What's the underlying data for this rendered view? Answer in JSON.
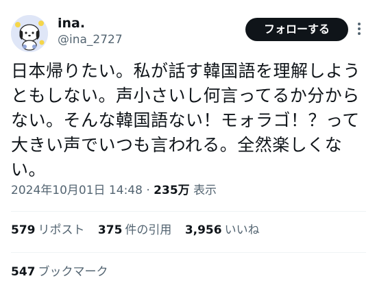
{
  "user": {
    "display_name": "ina.",
    "handle": "@ina_2727",
    "avatar_icon": "pochacco-avatar-icon"
  },
  "follow_button": {
    "label": "フォローする"
  },
  "more_icon": "more-vertical-icon",
  "post": {
    "text": "日本帰りたい。私が話す韓国語を理解しようともしない。声小さいし何言ってるか分からない。そんな韓国語ない！モォラゴ！？って大きい声でいつも言われる。全然楽しくない。"
  },
  "meta": {
    "timestamp": "2024年10月01日 14:48",
    "separator": "·",
    "views_count": "235万",
    "views_label": "表示"
  },
  "stats": {
    "reposts": {
      "count": "579",
      "label": "リポスト"
    },
    "quotes": {
      "count": "375",
      "label": "件の引用"
    },
    "likes": {
      "count": "3,956",
      "label": "いいね"
    }
  },
  "bookmarks": {
    "count": "547",
    "label": "ブックマーク"
  },
  "colors": {
    "text_primary": "#0f1419",
    "text_secondary": "#536471",
    "button_bg": "#0f1419",
    "button_text": "#ffffff",
    "divider": "#eff3f4"
  }
}
